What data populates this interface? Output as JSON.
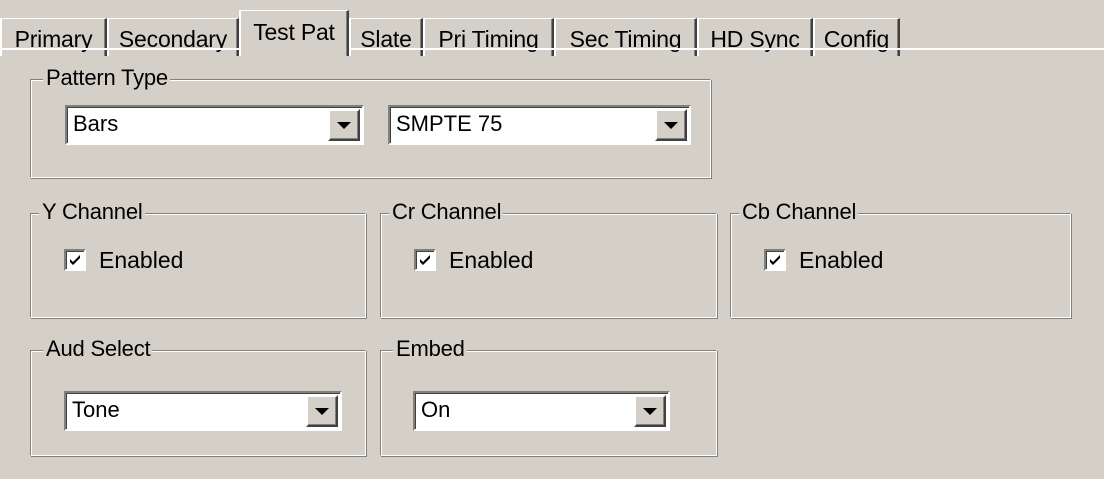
{
  "tabs": [
    {
      "label": "Primary",
      "active": false
    },
    {
      "label": "Secondary",
      "active": false
    },
    {
      "label": "Test Pat",
      "active": true
    },
    {
      "label": "Slate",
      "active": false
    },
    {
      "label": "Pri Timing",
      "active": false
    },
    {
      "label": "Sec Timing",
      "active": false
    },
    {
      "label": "HD Sync",
      "active": false
    },
    {
      "label": "Config",
      "active": false
    }
  ],
  "pattern_type": {
    "title": "Pattern Type",
    "type_value": "Bars",
    "variant_value": "SMPTE 75"
  },
  "y_channel": {
    "title": "Y Channel",
    "enabled_label": "Enabled",
    "checked": true
  },
  "cr_channel": {
    "title": "Cr Channel",
    "enabled_label": "Enabled",
    "checked": true
  },
  "cb_channel": {
    "title": "Cb Channel",
    "enabled_label": "Enabled",
    "checked": true
  },
  "aud_select": {
    "title": "Aud Select",
    "value": "Tone"
  },
  "embed": {
    "title": "Embed",
    "value": "On"
  },
  "icons": {
    "dropdown": "chevron-down-icon",
    "check": "checkmark-icon"
  }
}
